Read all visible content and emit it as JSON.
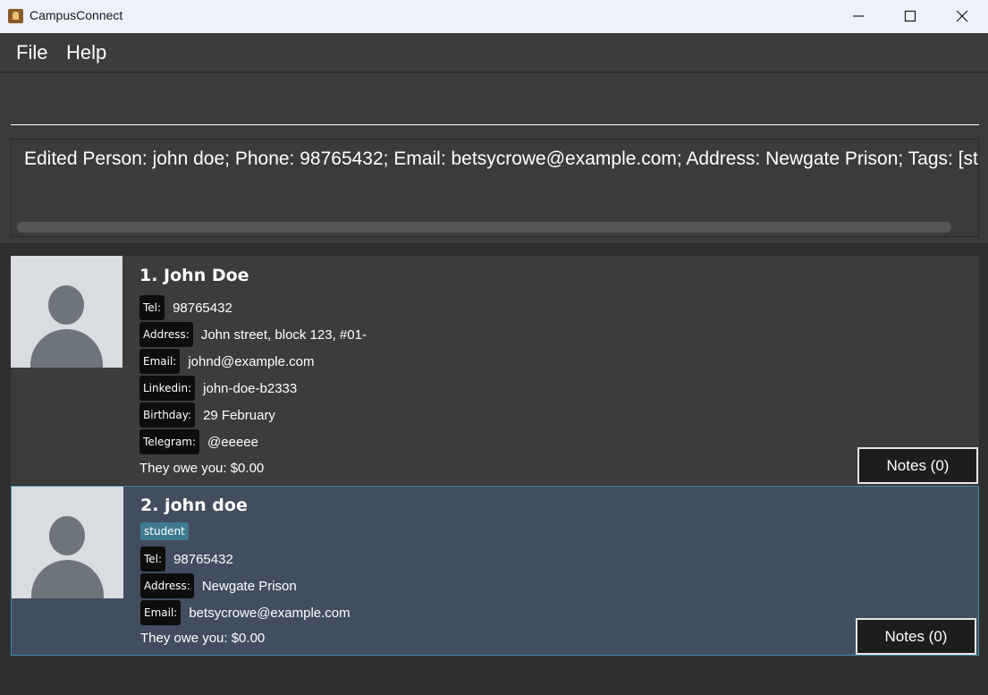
{
  "window": {
    "title": "CampusConnect"
  },
  "menu": {
    "file": "File",
    "help": "Help"
  },
  "command": {
    "value": "",
    "placeholder": ""
  },
  "result": {
    "text": "Edited Person: john doe; Phone: 98765432; Email: betsycrowe@example.com; Address: Newgate Prison; Tags: [studen"
  },
  "persons": [
    {
      "name": "1.  John Doe",
      "tags": [],
      "fields": [
        {
          "label": "Tel:",
          "value": "98765432"
        },
        {
          "label": "Address:",
          "value": "John street, block 123, #01-"
        },
        {
          "label": "Email:",
          "value": "johnd@example.com"
        },
        {
          "label": "Linkedin:",
          "value": "john-doe-b2333"
        },
        {
          "label": "Birthday:",
          "value": "29 February"
        },
        {
          "label": "Telegram:",
          "value": "@eeeee"
        }
      ],
      "owe": "They owe you: $0.00",
      "notes": "Notes (0)"
    },
    {
      "name": "2.  john doe",
      "tags": [
        "student"
      ],
      "fields": [
        {
          "label": "Tel:",
          "value": "98765432"
        },
        {
          "label": "Address:",
          "value": "Newgate Prison"
        },
        {
          "label": "Email:",
          "value": "betsycrowe@example.com"
        }
      ],
      "owe": "They owe you: $0.00",
      "notes": "Notes (0)"
    }
  ],
  "icons": {
    "app": "contacts-app-icon",
    "minimize": "minimize-icon",
    "maximize": "maximize-icon",
    "close": "close-icon",
    "avatar": "person-avatar-icon"
  },
  "colors": {
    "selected_card": "#424d5f",
    "tag": "#3e7b91",
    "label_bg": "#0d0d0d"
  }
}
